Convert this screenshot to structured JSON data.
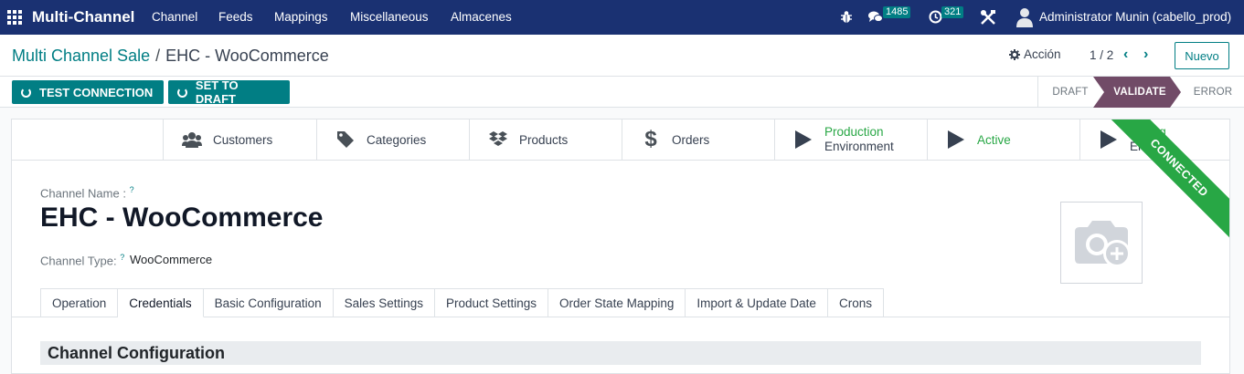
{
  "navbar": {
    "app_name": "Multi-Channel",
    "menu": [
      "Channel",
      "Feeds",
      "Mappings",
      "Miscellaneous",
      "Almacenes"
    ],
    "messages_count": "1485",
    "activities_count": "321",
    "user": "Administrator Munin (cabello_prod)"
  },
  "control_panel": {
    "breadcrumb_parent": "Multi Channel Sale",
    "breadcrumb_sep": "/",
    "breadcrumb_current": "EHC - WooCommerce",
    "action_label": "Acción",
    "pager": "1 / 2",
    "new_label": "Nuevo"
  },
  "statusbar": {
    "buttons": [
      "TEST CONNECTION",
      "SET TO DRAFT"
    ],
    "stages": [
      "DRAFT",
      "VALIDATE",
      "ERROR"
    ],
    "active_stage": "VALIDATE"
  },
  "smart_buttons": [
    {
      "label": "Customers",
      "icon": "users-icon"
    },
    {
      "label": "Categories",
      "icon": "tag-icon"
    },
    {
      "label": "Products",
      "icon": "dropbox-icon"
    },
    {
      "label": "Orders",
      "icon": "dollar-icon"
    },
    {
      "line1": "Production",
      "line2": "Environment",
      "icon": "play-icon"
    },
    {
      "label": "Active",
      "icon": "play-icon"
    },
    {
      "line1": "Debug",
      "line2": "Enable",
      "icon": "play-icon"
    }
  ],
  "ribbon": "CONNECTED",
  "form": {
    "channel_name_label": "Channel Name :",
    "channel_name": "EHC - WooCommerce",
    "channel_type_label": "Channel Type:",
    "channel_type": "WooCommerce",
    "help_mark": "?"
  },
  "tabs": [
    "Operation",
    "Credentials",
    "Basic Configuration",
    "Sales Settings",
    "Product Settings",
    "Order State Mapping",
    "Import & Update Date",
    "Crons"
  ],
  "active_tab": "Credentials",
  "section_title": "Channel Configuration",
  "colors": {
    "navbar": "#1a3172",
    "primary": "#017e84",
    "stage_active": "#714b67",
    "ribbon": "#28a745"
  }
}
